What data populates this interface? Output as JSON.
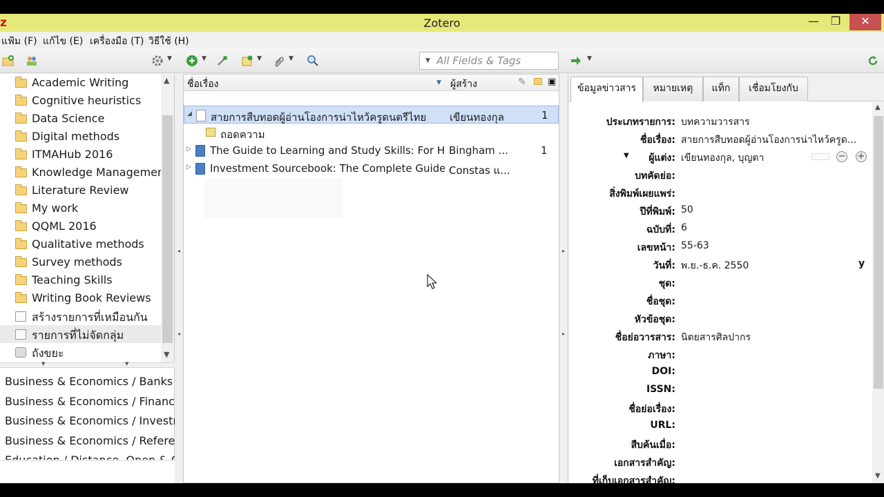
{
  "window": {
    "app_logo": "z",
    "title": "Zotero",
    "minimize": "—",
    "restore": "❐",
    "close": "✕"
  },
  "menu": [
    "แฟ้ม (F)",
    "แก้ไข (E)",
    "เครื่องมือ (T)",
    "วิธีใช้ (H)"
  ],
  "search": {
    "placeholder": "All Fields & Tags"
  },
  "collections": [
    {
      "label": "Academic Writing",
      "icon": "folder-icon"
    },
    {
      "label": "Cognitive heuristics",
      "icon": "folder-icon"
    },
    {
      "label": "Data Science",
      "icon": "folder-icon"
    },
    {
      "label": "Digital methods",
      "icon": "folder-icon"
    },
    {
      "label": "ITMAHub 2016",
      "icon": "folder-icon"
    },
    {
      "label": "Knowledge Management",
      "icon": "folder-icon"
    },
    {
      "label": "Literature Review",
      "icon": "folder-icon"
    },
    {
      "label": "My work",
      "icon": "folder-icon"
    },
    {
      "label": "QQML 2016",
      "icon": "folder-icon"
    },
    {
      "label": "Qualitative methods",
      "icon": "folder-icon"
    },
    {
      "label": "Survey methods",
      "icon": "folder-icon"
    },
    {
      "label": "Teaching Skills",
      "icon": "folder-icon"
    },
    {
      "label": "Writing Book Reviews",
      "icon": "folder-icon"
    },
    {
      "label": "สร้างรายการที่เหมือนกัน",
      "icon": "duplicate-icon"
    },
    {
      "label": "รายการที่ไม่จัดกลุ่ม",
      "icon": "unfiled-icon"
    },
    {
      "label": "ถังขยะ",
      "icon": "trash-icon"
    }
  ],
  "tags": [
    "Business & Economics / Banks & B",
    "Business & Economics / Finance /",
    "Business & Economics / Investmen",
    "Business & Economics / Reference",
    "Education / Distance, Open & Onl"
  ],
  "items_header": {
    "title_col": "ชื่อเรื่อง",
    "creator_col": "ผู้สร้าง"
  },
  "items": [
    {
      "title": "สายการสืบทอดผู้อ่านโองการน่าไหว้ครูดนตรีไทย",
      "creator": "เขียนทองกุล",
      "count": "1",
      "type": "journal-article-icon",
      "child": "ถอดความ"
    },
    {
      "title": "The Guide to Learning and Study Skills: For Hi...",
      "creator": "Bingham ...",
      "count": "1",
      "type": "book-icon"
    },
    {
      "title": "Investment Sourcebook: The Complete Guide...",
      "creator": "Constas แ...",
      "count": "",
      "type": "book-icon"
    }
  ],
  "tabs": [
    "ข้อมูลข่าวสาร",
    "หมายเหตุ",
    "แท็ก",
    "เชื่อมโยงกับ"
  ],
  "info_fields": [
    {
      "label": "ประเภทรายการ:",
      "value": "บทความวารสาร"
    },
    {
      "label": "ชื่อเรื่อง:",
      "value": "สายการสืบทอดผู้อ่านโองการน่าไหว้ครูด..."
    },
    {
      "label": "ผู้แต่ง:",
      "value": "เขียนทองกุล, บุญตา"
    },
    {
      "label": "บทคัดย่อ:",
      "value": ""
    },
    {
      "label": "สิ่งพิมพ์เผยแพร่:",
      "value": ""
    },
    {
      "label": "ปีที่พิมพ์:",
      "value": "50"
    },
    {
      "label": "ฉบับที่:",
      "value": "6"
    },
    {
      "label": "เลขหน้า:",
      "value": "55-63"
    },
    {
      "label": "วันที่:",
      "value": "พ.ย.-ธ.ค. 2550"
    },
    {
      "label": "ชุด:",
      "value": ""
    },
    {
      "label": "ชื่อชุด:",
      "value": ""
    },
    {
      "label": "หัวข้อชุด:",
      "value": ""
    },
    {
      "label": "ชื่อย่อวารสาร:",
      "value": "นิตยสารศิลปากร"
    },
    {
      "label": "ภาษา:",
      "value": ""
    },
    {
      "label": "DOI:",
      "value": ""
    },
    {
      "label": "ISSN:",
      "value": ""
    },
    {
      "label": "ชื่อย่อเรื่อง:",
      "value": ""
    },
    {
      "label": "URL:",
      "value": ""
    },
    {
      "label": "สืบค้นเมื่อ:",
      "value": ""
    },
    {
      "label": "เอกสารสำคัญ:",
      "value": ""
    },
    {
      "label": "ที่เก็บเอกสารสำคัญ:",
      "value": ""
    }
  ],
  "date_suffix": "y",
  "colors": {
    "titlebar": "#e7e87a",
    "selection": "#cfe0f7",
    "close_button": "#c75050"
  }
}
